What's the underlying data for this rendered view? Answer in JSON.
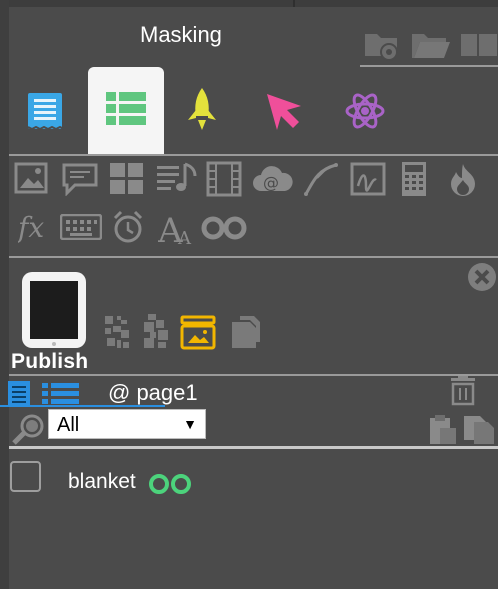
{
  "panel": {
    "title": "Masking"
  },
  "top_icons": [
    "folder-add-icon",
    "folder-open-icon",
    "book-icon"
  ],
  "category_tabs": [
    {
      "name": "document-icon",
      "color": "#3aa7e6",
      "active": false
    },
    {
      "name": "list-icon",
      "color": "#5fc67f",
      "active": true
    },
    {
      "name": "rocket-icon",
      "color": "#e3e13c",
      "active": false
    },
    {
      "name": "cursor-icon",
      "color": "#ef4f9a",
      "active": false
    },
    {
      "name": "atom-icon",
      "color": "#a963c7",
      "active": false
    }
  ],
  "tool_icons_row1": [
    "image-icon",
    "comment-icon",
    "grid-icon",
    "music-list-icon",
    "film-icon",
    "cloud-at-icon",
    "curve-icon",
    "signature-icon",
    "calculator-icon",
    "fire-icon"
  ],
  "tool_icons_row2": [
    "fx-icon",
    "keyboard-icon",
    "alarm-clock-icon",
    "font-size-icon",
    "infinity-icon"
  ],
  "publish": {
    "label": "Publish",
    "icons": [
      "qr-code-icon",
      "copy-qr-icon",
      "image-drawer-icon",
      "duplicate-icon"
    ]
  },
  "page": {
    "label": "@ page1"
  },
  "filter": {
    "selected": "All",
    "arrow": "▼"
  },
  "items": [
    {
      "label": "blanket",
      "badge_icon": "infinity-icon",
      "badge_color": "#4cd37c"
    }
  ],
  "colors": {
    "panel_bg": "#4b4b4b",
    "tab_blue": "#2a8fe0",
    "icon_gray": "#8a8a8a"
  }
}
